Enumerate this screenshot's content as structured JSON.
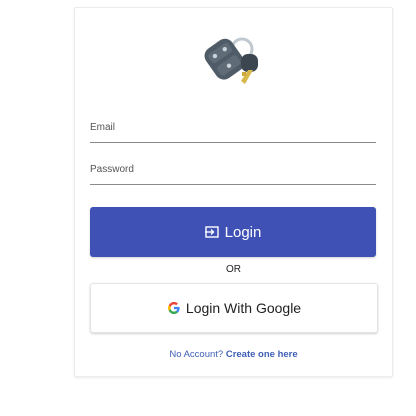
{
  "form": {
    "email_label": "Email",
    "password_label": "Password",
    "login_label": "Login",
    "or_text": "OR",
    "google_label": "Login With Google",
    "no_account_text": "No Account?",
    "create_link": "Create one here"
  },
  "colors": {
    "primary": "#3f51b5",
    "link": "#3f5fb5",
    "field_line": "#8a8a8a"
  },
  "icons": {
    "logo": "car-keys-icon",
    "login": "login-icon",
    "google": "google-icon"
  }
}
